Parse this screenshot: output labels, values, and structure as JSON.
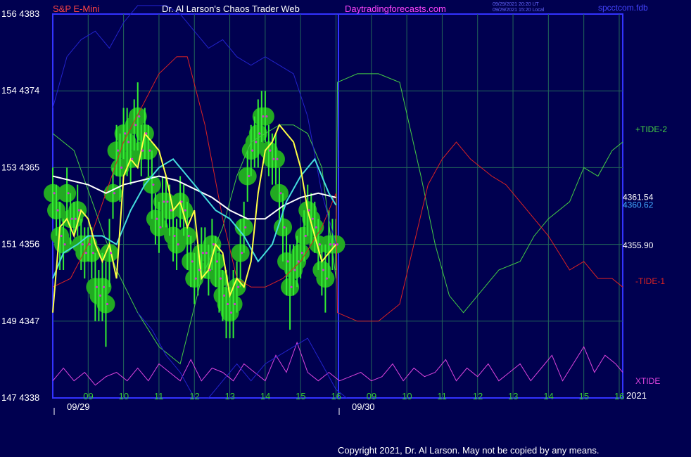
{
  "header": {
    "instrument": "S&P E-Mini",
    "site_title": "Dr. Al Larson's Chaos Trader Web",
    "site_url": "Daytradingforecasts.com",
    "timestamp_1": "09/29/2021 20:20 UT",
    "timestamp_2": "09/29/2021 15:20 Local",
    "brand": "spcctcom.fdb"
  },
  "footer": {
    "copyright": "Copyright 2021, Dr. Al Larson. May not be copied by any means."
  },
  "colors": {
    "background": "#000050",
    "frame": "#3333ff",
    "grid": "#22665a",
    "price_bar": "#33ee33",
    "price_dot": "#cc33cc",
    "swing_glow": "#22aa22",
    "fast_avg": "#ffff44",
    "mid_avg": "#44dddd",
    "slow_avg": "#ffffff",
    "tide_up": "#44cc44",
    "tide_down": "#dd2222",
    "xtide": "#dd44dd",
    "upper_band": "#2222cc"
  },
  "chart_data": {
    "type": "line",
    "title": "S&P E-Mini",
    "y_left_labels": [
      "156 4383",
      "154 4374",
      "153 4365",
      "151 4356",
      "149 4347",
      "147 4338"
    ],
    "y_values": [
      4383,
      4374,
      4365,
      4356,
      4347,
      4338
    ],
    "ylim": [
      4338,
      4383
    ],
    "x_hour_labels_day1": [
      "09",
      "10",
      "11",
      "12",
      "13",
      "14",
      "15",
      "16"
    ],
    "x_hour_labels_day2": [
      "09",
      "10",
      "11",
      "12",
      "13",
      "14",
      "15",
      "16"
    ],
    "dates": [
      "09/29",
      "09/30"
    ],
    "year": "2021",
    "xlim": [
      8.0,
      24.1
    ],
    "grid": true,
    "price_labels": [
      "4361.54",
      "4360.62",
      "4355.90"
    ],
    "price_label_values": [
      4361.54,
      4360.62,
      4355.9
    ],
    "series": [
      {
        "name": "+TIDE-2",
        "color": "#44cc44",
        "x": [
          8.0,
          8.6,
          9.2,
          9.8,
          10.4,
          11.0,
          11.6,
          12.2,
          12.8,
          13.2,
          13.6,
          14.0,
          14.4,
          14.8,
          15.2,
          15.6,
          16.0,
          16.04,
          16.6,
          17.2,
          17.8,
          18.4,
          18.8,
          19.2,
          19.6,
          20.0,
          20.6,
          21.2,
          21.6,
          22.0,
          22.6,
          23.0,
          23.4,
          23.8,
          24.1
        ],
        "y": [
          4369,
          4367,
          4360,
          4353,
          4348,
          4344,
          4342,
          4352,
          4358,
          4364,
          4368,
          4369,
          4370,
          4370,
          4369,
          4365,
          4352,
          4375,
          4376,
          4376,
          4375,
          4364,
          4356,
          4350,
          4348,
          4350,
          4353,
          4354,
          4357,
          4359,
          4361,
          4365,
          4364,
          4367,
          4368
        ]
      },
      {
        "name": "-TIDE-1",
        "color": "#dd2222",
        "x": [
          8.0,
          8.5,
          9.0,
          9.5,
          10.0,
          10.5,
          11.0,
          11.5,
          11.8,
          12.3,
          12.8,
          13.2,
          13.6,
          14.0,
          14.5,
          15.0,
          15.6,
          16.0,
          16.04,
          16.6,
          17.2,
          17.8,
          18.2,
          18.6,
          19.0,
          19.4,
          19.8,
          20.4,
          20.8,
          21.2,
          21.6,
          22.0,
          22.6,
          23.0,
          23.4,
          23.8,
          24.1
        ],
        "y": [
          4351,
          4352,
          4356,
          4362,
          4368,
          4372,
          4376,
          4378,
          4378,
          4370,
          4359,
          4352,
          4351,
          4351,
          4352,
          4354,
          4358,
          4362,
          4348,
          4347,
          4347,
          4349,
          4356,
          4363,
          4366,
          4368,
          4366,
          4364,
          4363,
          4361,
          4359,
          4357,
          4353,
          4354,
          4352,
          4352,
          4351
        ]
      },
      {
        "name": "XTIDE",
        "color": "#dd44dd",
        "x": [
          8.0,
          8.3,
          8.6,
          8.9,
          9.2,
          9.5,
          9.8,
          10.1,
          10.4,
          10.7,
          11.0,
          11.3,
          11.6,
          11.9,
          12.2,
          12.5,
          12.8,
          13.1,
          13.4,
          13.7,
          14.0,
          14.3,
          14.6,
          14.9,
          15.2,
          15.5,
          15.8,
          16.1,
          16.4,
          16.7,
          17.0,
          17.3,
          17.6,
          17.9,
          18.2,
          18.5,
          18.8,
          19.1,
          19.4,
          19.7,
          20.0,
          20.3,
          20.6,
          20.9,
          21.2,
          21.5,
          21.8,
          22.1,
          22.4,
          22.7,
          23.0,
          23.3,
          23.6,
          23.9,
          24.1
        ],
        "y": [
          4340,
          4341.5,
          4340,
          4341,
          4339.5,
          4340.5,
          4341,
          4340,
          4341.5,
          4340,
          4342,
          4341,
          4340,
          4342.5,
          4340,
          4341.5,
          4341,
          4340,
          4342,
          4341,
          4340,
          4343,
          4341,
          4344.5,
          4341,
          4340,
          4341,
          4340,
          4340.5,
          4341,
          4340,
          4340.5,
          4342,
          4340,
          4341.5,
          4340.5,
          4341,
          4342.5,
          4340,
          4341.5,
          4340.5,
          4342,
          4340,
          4341,
          4342,
          4340,
          4341.5,
          4343,
          4340,
          4342,
          4344,
          4341,
          4343,
          4342,
          4341
        ]
      },
      {
        "name": "upper band",
        "color": "#2222cc",
        "x": [
          8.0,
          8.4,
          8.8,
          9.2,
          9.6,
          10.0,
          10.4,
          10.8,
          11.2,
          11.6,
          12.0,
          12.4,
          12.8,
          13.2,
          13.6,
          14.0,
          14.4,
          14.8,
          15.2,
          15.6,
          16.0
        ],
        "y": [
          4372,
          4378,
          4380,
          4381,
          4379,
          4382,
          4384,
          4384,
          4384,
          4383,
          4381,
          4379,
          4380,
          4378,
          4377,
          4378,
          4377,
          4376,
          4371,
          4362,
          4356
        ]
      },
      {
        "name": "lower band",
        "color": "#2222cc",
        "x": [
          10.4,
          10.8,
          11.2,
          11.6,
          12.0,
          12.4,
          12.8,
          13.2,
          13.6,
          14.0,
          14.4,
          14.8,
          15.2,
          15.6,
          16.0,
          16.3
        ],
        "y": [
          4348,
          4346,
          4343,
          4341,
          4338,
          4338,
          4340,
          4342,
          4340,
          4342,
          4343,
          4344,
          4345,
          4342,
          4339,
          4338
        ]
      },
      {
        "name": "slow average",
        "color": "#ffffff",
        "x": [
          8.0,
          8.5,
          9.0,
          9.5,
          10.0,
          10.5,
          11.0,
          11.5,
          12.0,
          12.5,
          13.0,
          13.5,
          14.0,
          14.5,
          15.0,
          15.5,
          16.0
        ],
        "y": [
          4364,
          4363.5,
          4363,
          4362,
          4363,
          4363.5,
          4364,
          4363.5,
          4362.5,
          4361.5,
          4360,
          4359,
          4359,
          4360.5,
          4361.5,
          4362,
          4361.5
        ]
      },
      {
        "name": "mid average",
        "color": "#44dddd",
        "x": [
          8.0,
          8.3,
          8.7,
          9.0,
          9.4,
          9.8,
          10.2,
          10.6,
          11.0,
          11.4,
          11.8,
          12.2,
          12.6,
          13.0,
          13.4,
          13.8,
          14.2,
          14.6,
          15.0,
          15.4,
          15.8,
          16.0
        ],
        "y": [
          4352,
          4355,
          4356,
          4357,
          4357,
          4356,
          4360,
          4363,
          4365,
          4366,
          4364,
          4362,
          4360,
          4359,
          4357,
          4354,
          4356,
          4361,
          4364,
          4366,
          4362,
          4360.6
        ]
      },
      {
        "name": "fast average",
        "color": "#ffff44",
        "x": [
          8.0,
          8.2,
          8.4,
          8.6,
          8.8,
          9.0,
          9.2,
          9.4,
          9.6,
          9.8,
          10.0,
          10.2,
          10.4,
          10.6,
          10.8,
          11.0,
          11.2,
          11.4,
          11.6,
          11.8,
          12.0,
          12.2,
          12.4,
          12.6,
          12.8,
          13.0,
          13.2,
          13.4,
          13.6,
          13.8,
          14.0,
          14.2,
          14.4,
          14.6,
          14.8,
          15.0,
          15.2,
          15.4,
          15.6,
          15.8,
          16.0
        ],
        "y": [
          4348,
          4358,
          4359,
          4357,
          4360,
          4359,
          4356,
          4354,
          4356,
          4352,
          4364,
          4366,
          4365,
          4369,
          4368,
          4367,
          4364,
          4360,
          4361,
          4358,
          4360,
          4352,
          4353,
          4356,
          4355,
          4350,
          4352,
          4351,
          4354,
          4362,
          4367,
          4368,
          4370,
          4369,
          4368,
          4365,
          4360,
          4357,
          4354,
          4355,
          4356
        ]
      }
    ]
  },
  "price_points": {
    "x": [
      8.0,
      8.1,
      8.2,
      8.3,
      8.4,
      8.5,
      8.6,
      8.7,
      8.8,
      8.9,
      9.0,
      9.1,
      9.2,
      9.3,
      9.4,
      9.5,
      9.6,
      9.7,
      9.8,
      9.9,
      10.0,
      10.1,
      10.2,
      10.3,
      10.4,
      10.5,
      10.6,
      10.7,
      10.8,
      10.9,
      11.0,
      11.1,
      11.2,
      11.3,
      11.4,
      11.5,
      11.6,
      11.7,
      11.8,
      11.9,
      12.0,
      12.1,
      12.2,
      12.3,
      12.4,
      12.5,
      12.6,
      12.7,
      12.8,
      12.9,
      13.0,
      13.1,
      13.2,
      13.3,
      13.4,
      13.5,
      13.6,
      13.7,
      13.8,
      13.9,
      14.0,
      14.1,
      14.2,
      14.3,
      14.4,
      14.5,
      14.6,
      14.7,
      14.8,
      14.9,
      15.0,
      15.1,
      15.2,
      15.3,
      15.4,
      15.5,
      15.6,
      15.7,
      15.8,
      15.9,
      16.0
    ],
    "y": [
      4362,
      4360,
      4357,
      4356,
      4362,
      4359,
      4359,
      4360,
      4356,
      4355,
      4356,
      4355,
      4351,
      4350,
      4351,
      4349,
      4355,
      4362,
      4367,
      4365,
      4369,
      4368,
      4366,
      4370,
      4371,
      4367,
      4369,
      4367,
      4363,
      4359,
      4358,
      4361,
      4361,
      4360,
      4357,
      4356,
      4361,
      4360,
      4357,
      4354,
      4352,
      4353,
      4355,
      4355,
      4353,
      4356,
      4354,
      4352,
      4350,
      4349,
      4348,
      4349,
      4351,
      4355,
      4358,
      4364,
      4367,
      4368,
      4369,
      4371,
      4371,
      4367,
      4366,
      4366,
      4362,
      4358,
      4354,
      4351,
      4353,
      4354,
      4355,
      4357,
      4360,
      4359,
      4358,
      4356,
      4353,
      4352,
      4356,
      4356,
      4356
    ],
    "hl_range": [
      3,
      3,
      4,
      3,
      3,
      3,
      2,
      3,
      3,
      3,
      2,
      3,
      4,
      3,
      4,
      5,
      4,
      3,
      3,
      4,
      3,
      4,
      3,
      3,
      4,
      3,
      3,
      3,
      4,
      3,
      3,
      3,
      3,
      3,
      3,
      3,
      3,
      3,
      4,
      3,
      3,
      3,
      3,
      3,
      3,
      3,
      3,
      4,
      3,
      4,
      3,
      4,
      3,
      4,
      3,
      3,
      3,
      3,
      4,
      3,
      3,
      3,
      3,
      3,
      3,
      4,
      4,
      5,
      3,
      3,
      3,
      3,
      3,
      3,
      3,
      3,
      3,
      4,
      4,
      3,
      3
    ]
  },
  "labels": {
    "tide_up": "+TIDE-2",
    "tide_down": "-TIDE-1",
    "xtide": "XTIDE"
  }
}
